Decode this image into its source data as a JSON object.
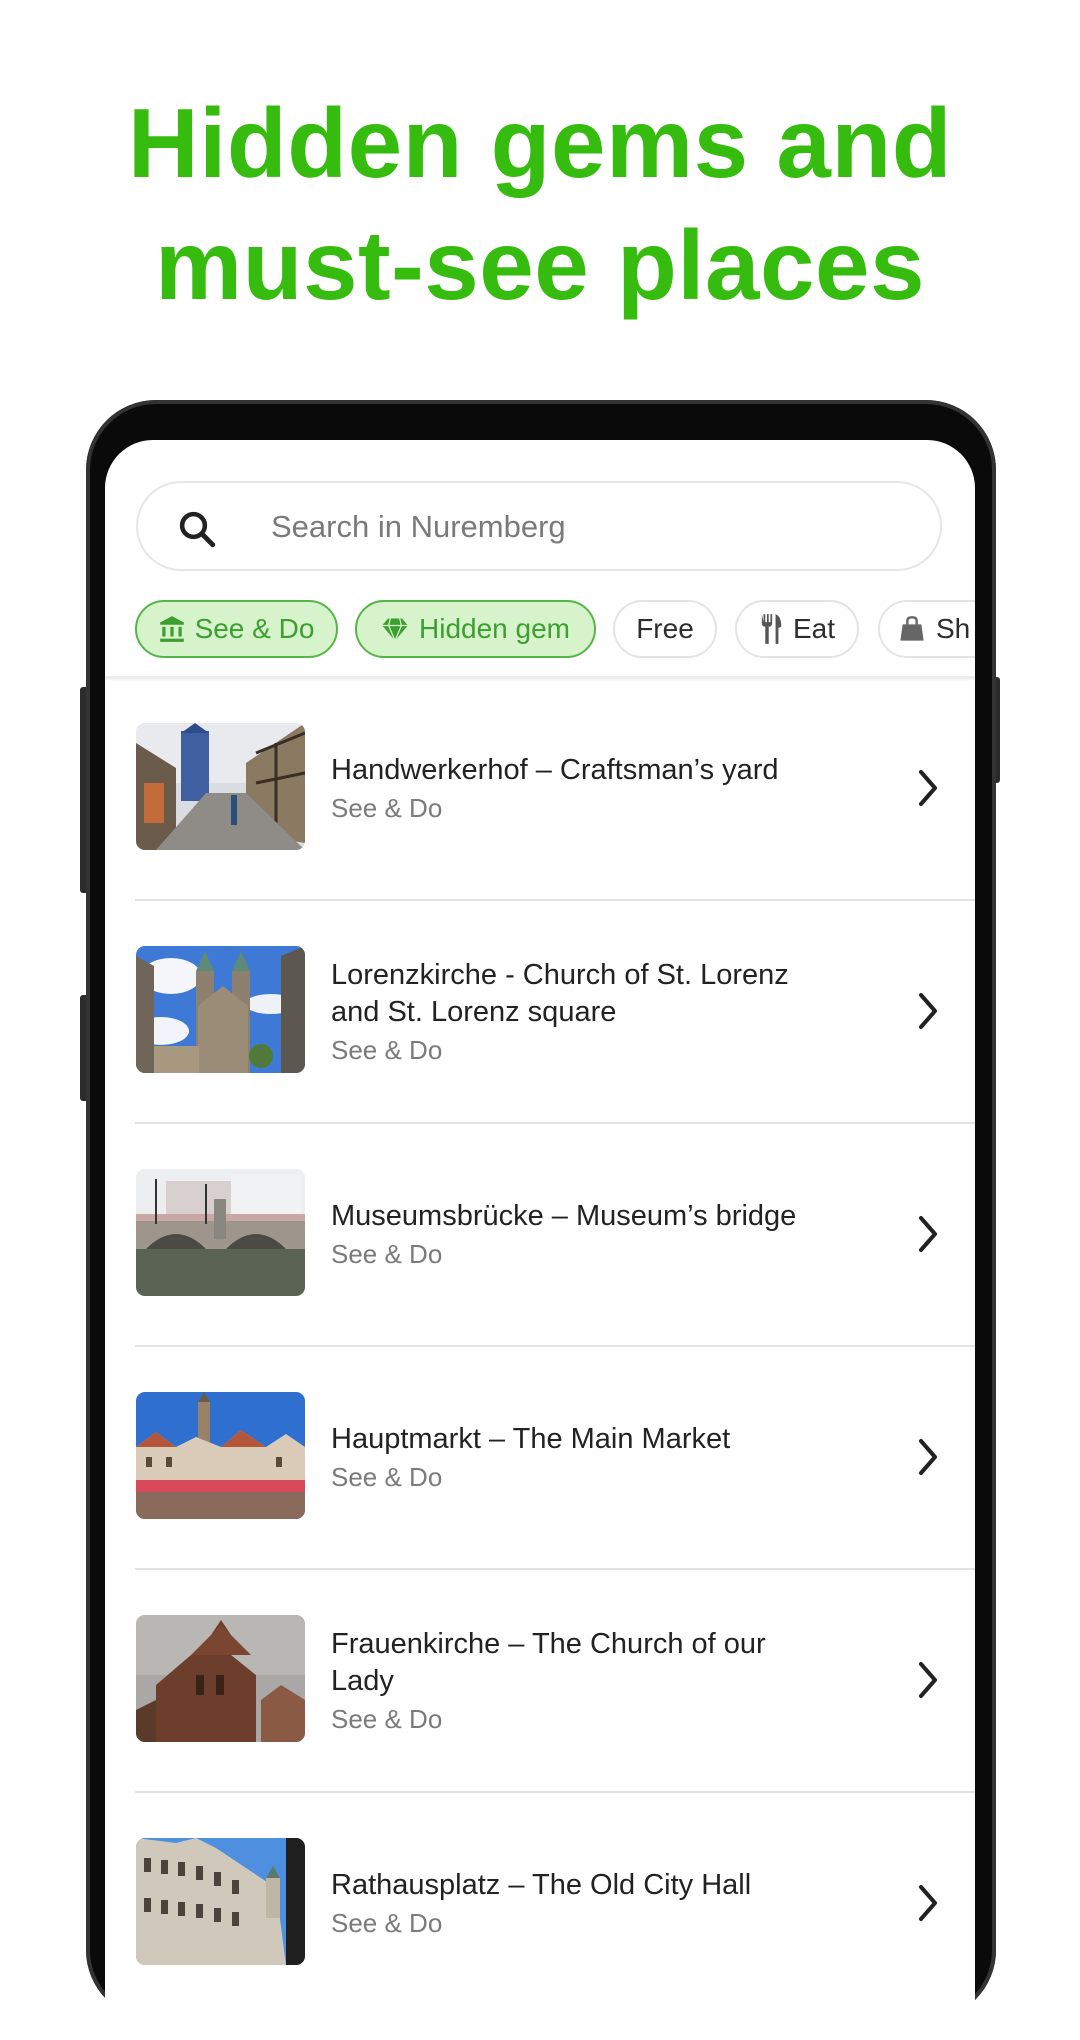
{
  "headline": {
    "line1": "Hidden gems and",
    "line2": "must-see places",
    "color": "#36bb0f"
  },
  "search": {
    "icon": "search-icon",
    "placeholder": "Search in Nuremberg"
  },
  "chips": [
    {
      "label": "See & Do",
      "icon": "museum-icon",
      "active": true
    },
    {
      "label": "Hidden gem",
      "icon": "diamond-icon",
      "active": true
    },
    {
      "label": "Free",
      "icon": null,
      "active": false
    },
    {
      "label": "Eat",
      "icon": "fork-knife-icon",
      "active": false
    },
    {
      "label": "Sh",
      "icon": "shopping-bag-icon",
      "active": false
    }
  ],
  "places": [
    {
      "title": "Handwerkerhof – Craftsman’s yard",
      "category": "See & Do",
      "thumbnail": "craftsmans-yard-photo"
    },
    {
      "title": "Lorenzkirche - Church of St. Lorenz and St. Lorenz square",
      "category": "See & Do",
      "thumbnail": "lorenzkirche-photo"
    },
    {
      "title": "Museumsbrücke – Museum’s bridge",
      "category": "See & Do",
      "thumbnail": "museum-bridge-photo"
    },
    {
      "title": "Hauptmarkt – The Main Market",
      "category": "See & Do",
      "thumbnail": "main-market-photo"
    },
    {
      "title": "Frauenkirche – The Church of our Lady",
      "category": "See & Do",
      "thumbnail": "frauenkirche-photo"
    },
    {
      "title": "Rathausplatz – The Old City Hall",
      "category": "See & Do",
      "thumbnail": "old-city-hall-photo"
    }
  ],
  "colors": {
    "accent": "#36bb0f",
    "chip_active_bg": "#d6f3cb",
    "chip_active_border": "#56b548",
    "chip_active_text": "#3c9f2f"
  }
}
